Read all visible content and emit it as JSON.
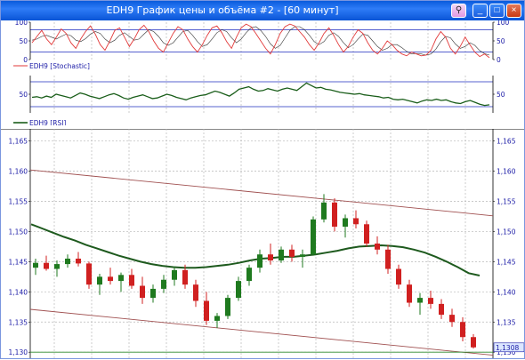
{
  "window": {
    "title": "EDH9 График цены и объёма #2 - [60 минут]",
    "buttons": {
      "pin": "⚲",
      "minimize": "_",
      "maximize": "□",
      "close": "×"
    }
  },
  "colors": {
    "grid": "#b8b8b8",
    "stochastic": "#e23a3a",
    "stochastic_signal": "#333333",
    "rsi": "#1a5e1a",
    "level": "#1f2fbf",
    "axis_text": "#1a1aa6",
    "bull": "#1f7a1f",
    "bear": "#d02020",
    "ma": "#1e5a1e",
    "channel": "#a05050",
    "support": "#2d8a2d",
    "price_marker_bg": "#dbe6ff"
  },
  "chart_data": [
    {
      "type": "line",
      "legend": "EDH9 [Stochastic]",
      "ylim": [
        0,
        100
      ],
      "yticks": [
        0,
        50,
        100
      ],
      "levels": [
        20,
        80
      ],
      "series": [
        {
          "name": "EDH9 [Stochastic]",
          "values": [
            45,
            62,
            78,
            55,
            40,
            60,
            82,
            70,
            45,
            30,
            55,
            75,
            90,
            68,
            40,
            25,
            50,
            78,
            85,
            60,
            35,
            55,
            80,
            92,
            75,
            50,
            30,
            20,
            45,
            70,
            88,
            80,
            55,
            35,
            20,
            40,
            65,
            85,
            90,
            72,
            48,
            30,
            60,
            85,
            95,
            88,
            70,
            50,
            30,
            15,
            40,
            70,
            88,
            95,
            90,
            75,
            60,
            40,
            25,
            45,
            70,
            85,
            65,
            40,
            20,
            35,
            60,
            80,
            70,
            45,
            25,
            15,
            30,
            50,
            40,
            25,
            15,
            10,
            20,
            15,
            10,
            12,
            25,
            55,
            75,
            60,
            30,
            15,
            35,
            60,
            40,
            20,
            8,
            15,
            5
          ]
        },
        {
          "name": "signal",
          "values": [
            52,
            55,
            62,
            65,
            60,
            55,
            62,
            68,
            64,
            52,
            48,
            56,
            68,
            75,
            70,
            55,
            45,
            52,
            65,
            72,
            62,
            52,
            55,
            68,
            80,
            75,
            62,
            45,
            38,
            45,
            60,
            75,
            78,
            65,
            48,
            35,
            40,
            55,
            72,
            80,
            75,
            58,
            45,
            55,
            72,
            85,
            88,
            78,
            62,
            42,
            30,
            38,
            58,
            78,
            88,
            88,
            80,
            65,
            48,
            40,
            48,
            65,
            72,
            62,
            45,
            32,
            40,
            55,
            68,
            65,
            50,
            35,
            25,
            30,
            40,
            40,
            32,
            22,
            15,
            16,
            15,
            12,
            15,
            28,
            48,
            62,
            58,
            42,
            30,
            35,
            45,
            38,
            24,
            16,
            12
          ]
        }
      ]
    },
    {
      "type": "line",
      "legend": "EDH9 [RSI]",
      "ylim": [
        20,
        80
      ],
      "yticks": [
        50
      ],
      "levels": [
        30,
        70
      ],
      "series": [
        {
          "name": "EDH9 [RSI]",
          "values": [
            45,
            46,
            44,
            47,
            45,
            50,
            48,
            46,
            44,
            48,
            52,
            50,
            47,
            45,
            43,
            46,
            49,
            51,
            48,
            44,
            42,
            45,
            47,
            49,
            46,
            43,
            44,
            47,
            50,
            48,
            45,
            43,
            41,
            44,
            46,
            48,
            49,
            52,
            55,
            53,
            50,
            47,
            52,
            58,
            60,
            62,
            58,
            55,
            56,
            59,
            57,
            55,
            58,
            60,
            58,
            56,
            62,
            68,
            64,
            60,
            61,
            58,
            57,
            55,
            53,
            52,
            51,
            50,
            51,
            49,
            48,
            47,
            46,
            44,
            45,
            42,
            41,
            42,
            40,
            38,
            36,
            39,
            41,
            40,
            42,
            40,
            41,
            38,
            36,
            35,
            38,
            40,
            37,
            34,
            32,
            33
          ]
        }
      ]
    },
    {
      "type": "candlestick",
      "ylim": [
        1.129,
        1.167
      ],
      "yticks": [
        "1,130",
        "1,135",
        "1,140",
        "1,145",
        "1,150",
        "1,155",
        "1,160",
        "1,165"
      ],
      "current_price": "1,1308",
      "support_level": 1.13,
      "channel_upper": [
        1.1602,
        1.1526
      ],
      "channel_lower": [
        1.1371,
        1.1295
      ],
      "ma": [
        1.1512,
        1.1505,
        1.1498,
        1.1491,
        1.1485,
        1.1478,
        1.1472,
        1.1466,
        1.146,
        1.1455,
        1.145,
        1.1446,
        1.1443,
        1.1441,
        1.144,
        1.144,
        1.1441,
        1.1443,
        1.1445,
        1.1448,
        1.1452,
        1.1455,
        1.1456,
        1.1458,
        1.1458,
        1.146,
        1.1462,
        1.1465,
        1.1468,
        1.1472,
        1.1475,
        1.1476,
        1.1477,
        1.1476,
        1.1474,
        1.147,
        1.1465,
        1.1458,
        1.145,
        1.1441,
        1.1431,
        1.1427
      ],
      "candles": [
        [
          1.144,
          1.1455,
          1.1428,
          1.1448
        ],
        [
          1.1448,
          1.146,
          1.1435,
          1.1438
        ],
        [
          1.1438,
          1.1452,
          1.1425,
          1.1446
        ],
        [
          1.1446,
          1.1462,
          1.144,
          1.1455
        ],
        [
          1.1455,
          1.1466,
          1.1442,
          1.1447
        ],
        [
          1.1447,
          1.145,
          1.1405,
          1.1412
        ],
        [
          1.1412,
          1.143,
          1.1395,
          1.1425
        ],
        [
          1.1425,
          1.144,
          1.1412,
          1.1418
        ],
        [
          1.1418,
          1.1432,
          1.14,
          1.1428
        ],
        [
          1.1428,
          1.1438,
          1.1405,
          1.141
        ],
        [
          1.141,
          1.1425,
          1.138,
          1.139
        ],
        [
          1.139,
          1.1412,
          1.1382,
          1.1405
        ],
        [
          1.1405,
          1.1428,
          1.1398,
          1.142
        ],
        [
          1.142,
          1.1442,
          1.141,
          1.1436
        ],
        [
          1.1436,
          1.1445,
          1.1405,
          1.1412
        ],
        [
          1.1412,
          1.142,
          1.1375,
          1.1385
        ],
        [
          1.1385,
          1.14,
          1.1345,
          1.1352
        ],
        [
          1.1352,
          1.1365,
          1.134,
          1.136
        ],
        [
          1.136,
          1.1395,
          1.1355,
          1.139
        ],
        [
          1.139,
          1.1425,
          1.1385,
          1.1418
        ],
        [
          1.1418,
          1.1445,
          1.141,
          1.144
        ],
        [
          1.144,
          1.147,
          1.1432,
          1.1462
        ],
        [
          1.1462,
          1.148,
          1.1445,
          1.1452
        ],
        [
          1.1452,
          1.1475,
          1.1448,
          1.147
        ],
        [
          1.147,
          1.1478,
          1.145,
          1.1458
        ],
        [
          1.1458,
          1.147,
          1.144,
          1.1462
        ],
        [
          1.1462,
          1.1525,
          1.146,
          1.152
        ],
        [
          1.152,
          1.1562,
          1.1515,
          1.1548
        ],
        [
          1.1548,
          1.1555,
          1.15,
          1.1508
        ],
        [
          1.1508,
          1.1528,
          1.149,
          1.1522
        ],
        [
          1.1522,
          1.1535,
          1.1505,
          1.1512
        ],
        [
          1.1512,
          1.1518,
          1.1475,
          1.148
        ],
        [
          1.148,
          1.1492,
          1.1462,
          1.147
        ],
        [
          1.147,
          1.1478,
          1.143,
          1.1438
        ],
        [
          1.1438,
          1.1445,
          1.1405,
          1.1412
        ],
        [
          1.1412,
          1.142,
          1.1375,
          1.1382
        ],
        [
          1.1382,
          1.1398,
          1.1362,
          1.139
        ],
        [
          1.139,
          1.1402,
          1.1372,
          1.138
        ],
        [
          1.138,
          1.1388,
          1.1355,
          1.1362
        ],
        [
          1.1362,
          1.1372,
          1.1342,
          1.135
        ],
        [
          1.135,
          1.1358,
          1.1318,
          1.1325
        ],
        [
          1.1325,
          1.133,
          1.1306,
          1.1308
        ]
      ]
    }
  ]
}
